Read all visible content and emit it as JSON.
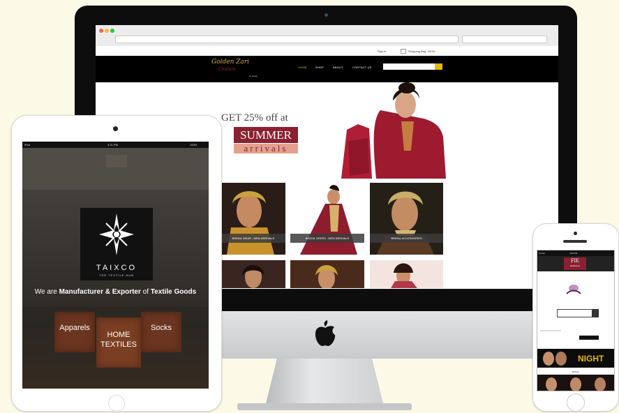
{
  "colors": {
    "background": "#fcf9e6",
    "bezel": "#0d0d0d",
    "promo_red": "#8a2030",
    "promo_peach": "#e2a18c",
    "accent_gold": "#d4af37",
    "search_yellow": "#e6b800"
  },
  "desktop": {
    "topbar": {
      "signin": "Sign in",
      "cart": "Shopping Bag : £0.00"
    },
    "logo": {
      "name": "Golden Zari",
      "script": "Couture",
      "tag": "by Nazia"
    },
    "nav": [
      "HOME",
      "SHOP",
      "ABOUT",
      "CONTACT US"
    ],
    "promo": {
      "line1": "GET 25% off at",
      "line2": "SUMMER",
      "line3": "arrivals"
    },
    "tiles": [
      "BRIDAL WEAR - NEW ARRIVALS",
      "BRIDAL DRESS - NEW ARRIVALS",
      "BRIDAL ACCESSORIES"
    ],
    "apple_icon": "apple-logo-icon"
  },
  "tablet": {
    "status": {
      "carrier": "iPad",
      "time": "4:21 PM",
      "battery": "100%"
    },
    "brand": {
      "name": "TAIXCO",
      "tagline": "THE TEXTILE HUB"
    },
    "headline": {
      "pre": "We are ",
      "strong1": "Manufacturer & Exporter",
      "mid": " of ",
      "strong2": "Textile Goods"
    },
    "boxes": {
      "apparels": "Apparels",
      "home": "HOME",
      "textiles": "TEXTILES",
      "socks": "Socks"
    },
    "logo_icon": "compass-star-icon"
  },
  "phone": {
    "status": {
      "carrier": "Carrier",
      "time": "4:20 PM"
    },
    "logo": {
      "text": "FIE",
      "sub": "Meditations"
    },
    "banner": {
      "text": "NIGHT"
    },
    "section": {
      "label": "BRIDAL"
    }
  }
}
